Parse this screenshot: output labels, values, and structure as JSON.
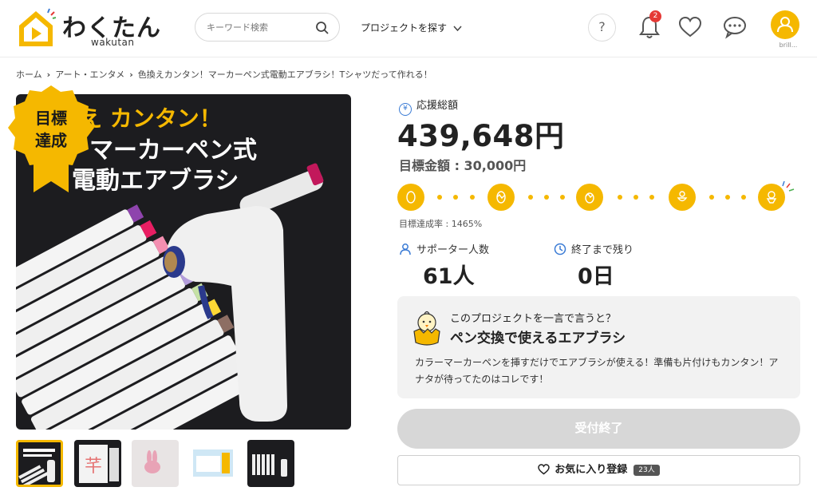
{
  "header": {
    "logo_text": "わくたん",
    "logo_sub": "wakutan",
    "search_placeholder": "キーワード検索",
    "project_menu_label": "プロジェクトを探す",
    "help_label": "?",
    "notification_count": "2",
    "user_name": "brill..."
  },
  "breadcrumb": {
    "items": [
      "ホーム",
      "アート・エンタメ",
      "色換えカンタン！マーカーペン式電動エアブラシ！Tシャツだって作れる！"
    ]
  },
  "main_image": {
    "headline_1": "え カンタン！",
    "headline_2": "マーカーペン式",
    "headline_3": "電動エアブラシ",
    "badge_line1": "目標",
    "badge_line2": "達成"
  },
  "thumbnails": [
    {
      "label": "thumb-airbrush"
    },
    {
      "label": "thumb-stencil"
    },
    {
      "label": "thumb-bunny"
    },
    {
      "label": "thumb-package"
    },
    {
      "label": "thumb-pens"
    }
  ],
  "funding": {
    "amount_label": "応援総額",
    "yen_symbol": "¥",
    "amount": "439,648円",
    "goal": "目標金額 : 30,000円",
    "achievement_rate": "目標達成率 : 1465%",
    "progress_percent": 100
  },
  "stats": {
    "supporters_label": "サポーター人数",
    "supporters_value": "61人",
    "remaining_label": "終了まで残り",
    "remaining_value": "0日"
  },
  "pitch": {
    "question": "このプロジェクトを一言で言うと？",
    "title": "ペン交換で使えるエアブラシ",
    "description": "カラーマーカーペンを挿すだけでエアブラシが使える！準備も片付けもカンタン！アナタが待ってたのはコレです！"
  },
  "actions": {
    "closed_label": "受付終了",
    "favorite_label": "お気に入り登録",
    "favorite_count": "23人"
  },
  "colors": {
    "accent": "#f5b800",
    "closed_button": "#d7d7d7",
    "icon_blue": "#3a7bd5",
    "badge_red": "#e53935"
  }
}
